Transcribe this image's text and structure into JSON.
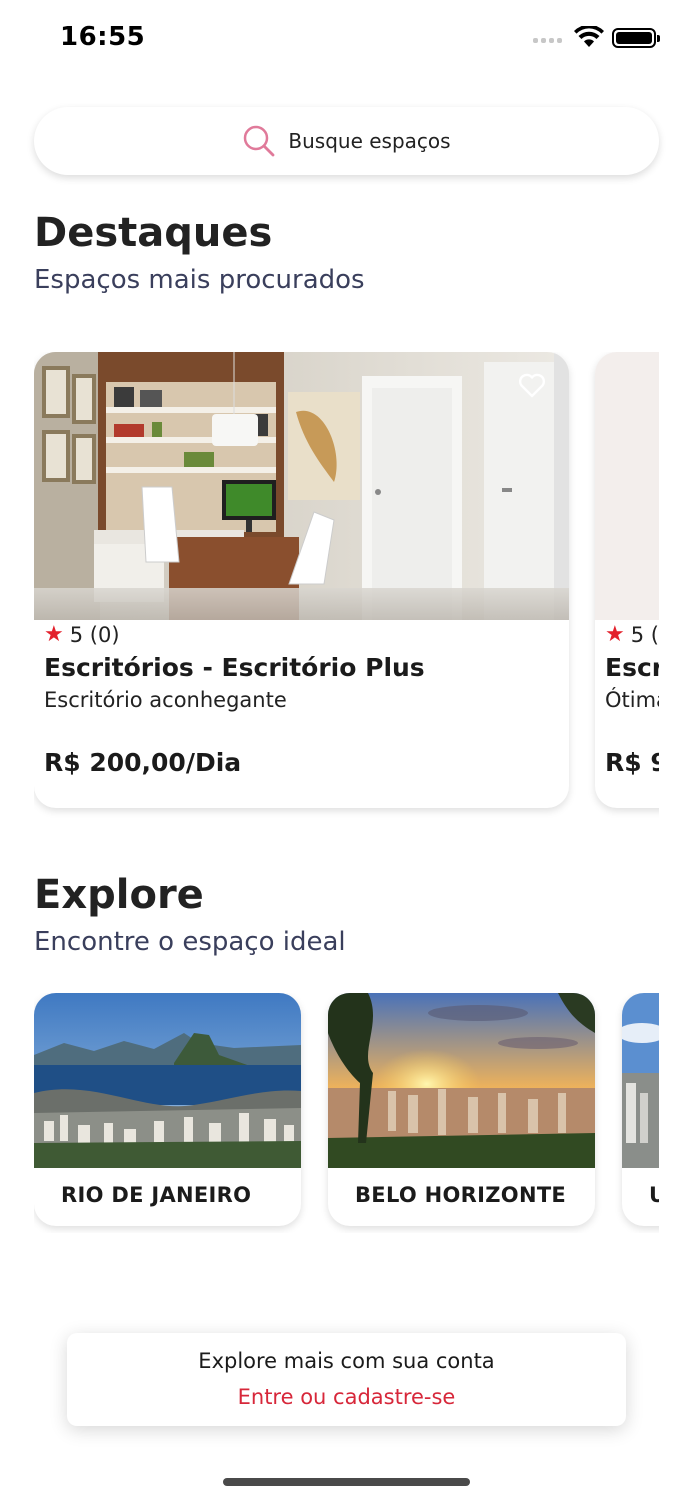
{
  "status_bar": {
    "time": "16:55"
  },
  "search": {
    "placeholder": "Busque espaços",
    "icon": "search-icon",
    "icon_color": "#e07a9a"
  },
  "highlights": {
    "title": "Destaques",
    "subtitle": "Espaços  mais procurados",
    "cards": [
      {
        "rating": "5 (0)",
        "title": "Escritórios  - Escritório Plus",
        "description": "Escritório aconhegante",
        "price": "R$ 200,00/Dia",
        "favorite_icon": "heart-outline-icon"
      },
      {
        "rating": "5 (",
        "title": "Escr",
        "description": "Ótima",
        "price": "R$ 9"
      }
    ]
  },
  "explore": {
    "title": "Explore",
    "subtitle": "Encontre o espaço ideal",
    "cities": [
      {
        "name": "RIO DE JANEIRO"
      },
      {
        "name": "BELO HORIZONTE"
      },
      {
        "name": "U"
      }
    ]
  },
  "login_banner": {
    "text": "Explore mais com sua conta",
    "link": "Entre ou cadastre-se",
    "link_color": "#d7273a"
  },
  "colors": {
    "star": "#e3202b",
    "subtitle": "#3a3f5c"
  }
}
